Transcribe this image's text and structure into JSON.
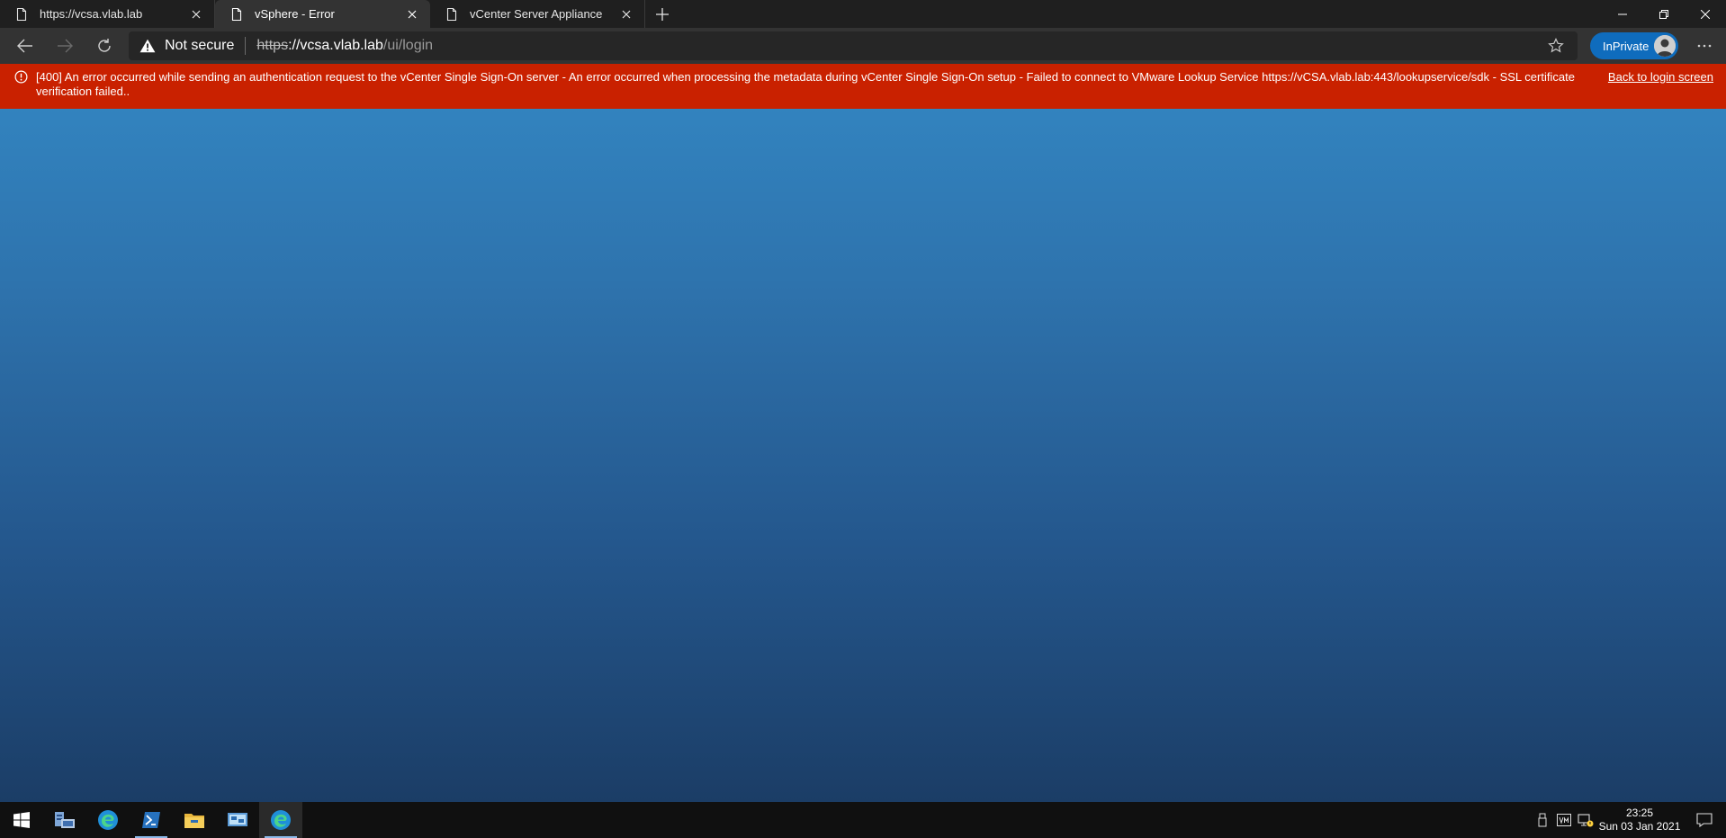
{
  "browser": {
    "tabs": [
      {
        "title": "https://vcsa.vlab.lab",
        "active": false
      },
      {
        "title": "vSphere - Error",
        "active": true
      },
      {
        "title": "vCenter Server Appliance",
        "active": false
      }
    ],
    "security_label": "Not secure",
    "url": {
      "scheme": "https",
      "host": "://vcsa.vlab.lab",
      "path": "/ui/login"
    },
    "inprivate_label": "InPrivate"
  },
  "error": {
    "message": "[400] An error occurred while sending an authentication request to the vCenter Single Sign-On server - An error occurred when processing the metadata during vCenter Single Sign-On setup - Failed to connect to VMware Lookup Service https://vCSA.vlab.lab:443/lookupservice/sdk - SSL certificate verification failed..",
    "back_link": "Back to login screen",
    "color": "#c92100"
  },
  "taskbar": {
    "apps": [
      "start-icon",
      "server-manager-icon",
      "edge-icon",
      "powershell-icon",
      "file-explorer-icon",
      "remote-desktop-icon",
      "edge-icon"
    ],
    "time": "23:25",
    "date": "Sun 03 Jan 2021"
  }
}
